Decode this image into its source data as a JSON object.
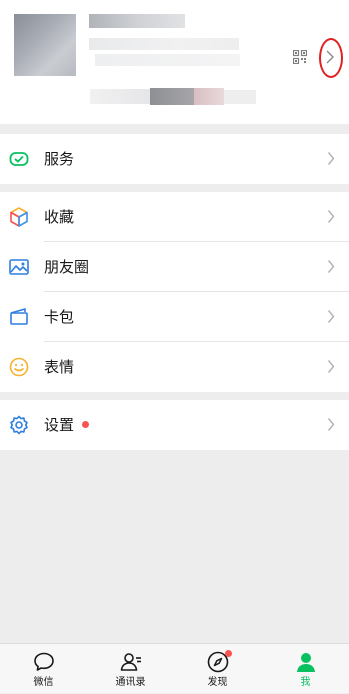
{
  "profile": {
    "qr_icon": "qr-code-icon",
    "chevron_icon": "chevron-right-icon",
    "annotation": "red-circle-annotation"
  },
  "menu": {
    "services": {
      "label": "服务",
      "icon": "wallet-check-icon"
    },
    "favorites": {
      "label": "收藏",
      "icon": "cube-icon"
    },
    "moments": {
      "label": "朋友圈",
      "icon": "landscape-photo-icon"
    },
    "cards": {
      "label": "卡包",
      "icon": "card-holder-icon"
    },
    "stickers": {
      "label": "表情",
      "icon": "smiley-icon"
    },
    "settings": {
      "label": "设置",
      "icon": "gear-icon",
      "has_dot": true
    }
  },
  "tabbar": {
    "tabs": [
      {
        "label": "微信",
        "icon": "chat-bubble-icon",
        "active": false
      },
      {
        "label": "通讯录",
        "icon": "contacts-icon",
        "active": false
      },
      {
        "label": "发现",
        "icon": "compass-icon",
        "active": false,
        "has_dot": true
      },
      {
        "label": "我",
        "icon": "person-icon",
        "active": true
      }
    ]
  },
  "colors": {
    "accent_green": "#07c160",
    "notification_red": "#fa5151",
    "annotation_red": "#e02020",
    "background": "#ededed"
  }
}
